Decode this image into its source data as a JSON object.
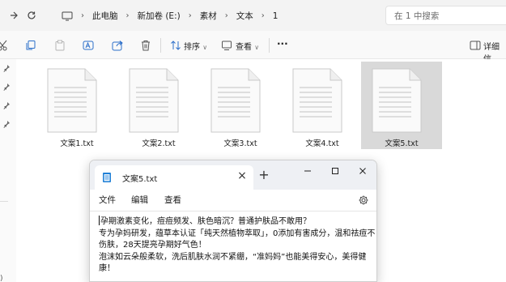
{
  "address_bar": {
    "breadcrumbs": [
      "此电脑",
      "新加卷 (E:)",
      "素材",
      "文本",
      "1"
    ],
    "search_placeholder": "在 1 中搜索"
  },
  "toolbar": {
    "sort_label": "排序",
    "view_label": "查看",
    "more_label": "···",
    "details_label": "详细信"
  },
  "files": [
    {
      "name": "文案1.txt",
      "selected": false
    },
    {
      "name": "文案2.txt",
      "selected": false
    },
    {
      "name": "文案3.txt",
      "selected": false
    },
    {
      "name": "文案4.txt",
      "selected": false
    },
    {
      "name": "文案5.txt",
      "selected": true
    }
  ],
  "notepad": {
    "tab_title": "文案5.txt",
    "menu": [
      "文件",
      "编辑",
      "查看"
    ],
    "content_lines": [
      "孕期激素变化，痘痘频发、肤色暗沉？普通护肤品不敢用？",
      "专为孕妈研发，蕴草本认证「纯天然植物萃取」，0添加有害成分，温和祛痘不伤肤，28天提亮孕期好气色！",
      "泡沫如云朵般柔软，洗后肌肤水润不紧绷，“准妈妈”也能美得安心，美得健康！"
    ]
  },
  "colors": {
    "selected_tile": "#d9d9d9",
    "window_bg": "#f3f3f3",
    "notepad_titlebar": "#eef0f4"
  }
}
